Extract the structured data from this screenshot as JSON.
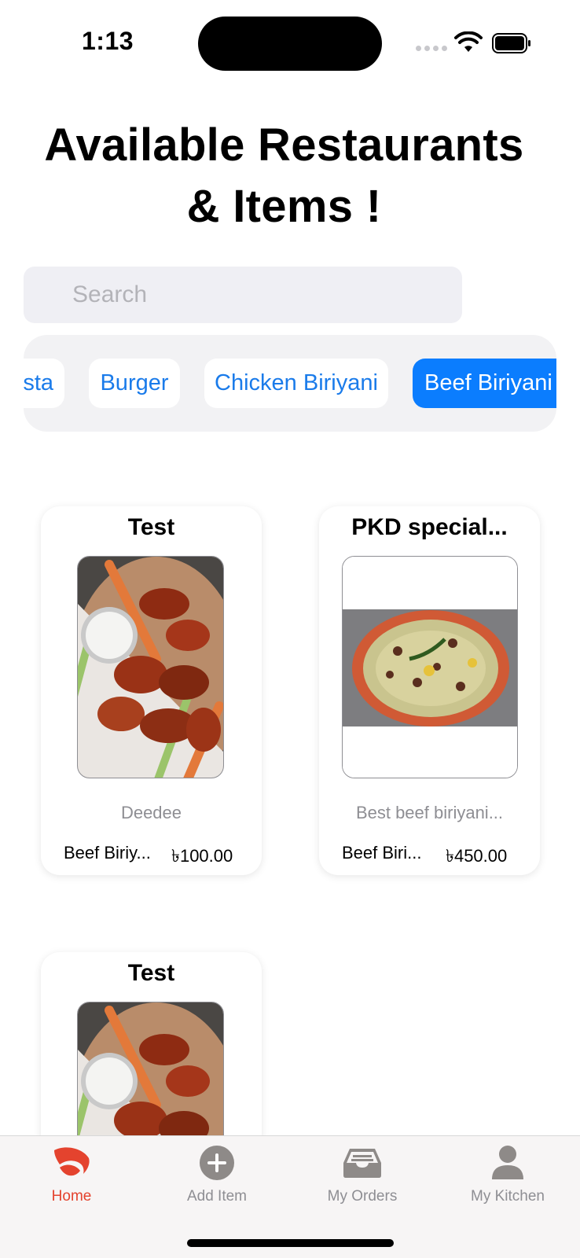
{
  "status": {
    "time": "1:13"
  },
  "page": {
    "title_line1": "Available Restaurants",
    "title_line2": "& Items !"
  },
  "search": {
    "placeholder": "Search",
    "value": ""
  },
  "categories": [
    {
      "label": "Pasta",
      "visible_text": "sta"
    },
    {
      "label": "Burger"
    },
    {
      "label": "Chicken Biriyani"
    },
    {
      "label": "Beef Biriyani",
      "selected": true
    }
  ],
  "items": [
    {
      "title": "Test",
      "description": "Deedee",
      "category": "Beef Biriy...",
      "price": "৳100.00",
      "image": "chicken-wings-photo"
    },
    {
      "title": "PKD special...",
      "description": "Best beef biriyani...",
      "category": "Beef Biri...",
      "price": "৳450.00",
      "image": "beef-biriyani-photo"
    },
    {
      "title": "Test",
      "description": "",
      "category": "",
      "price": "",
      "image": "chicken-wings-photo"
    }
  ],
  "tabbar": {
    "tabs": [
      {
        "label": "Home",
        "icon": "home-leaf-icon",
        "active": true
      },
      {
        "label": "Add Item",
        "icon": "plus-circle-icon"
      },
      {
        "label": "My Orders",
        "icon": "tray-icon"
      },
      {
        "label": "My Kitchen",
        "icon": "person-icon"
      }
    ]
  },
  "colors": {
    "accent": "#0b7dfe",
    "tab_active": "#e4432e",
    "tab_inactive": "#8e8e93"
  }
}
